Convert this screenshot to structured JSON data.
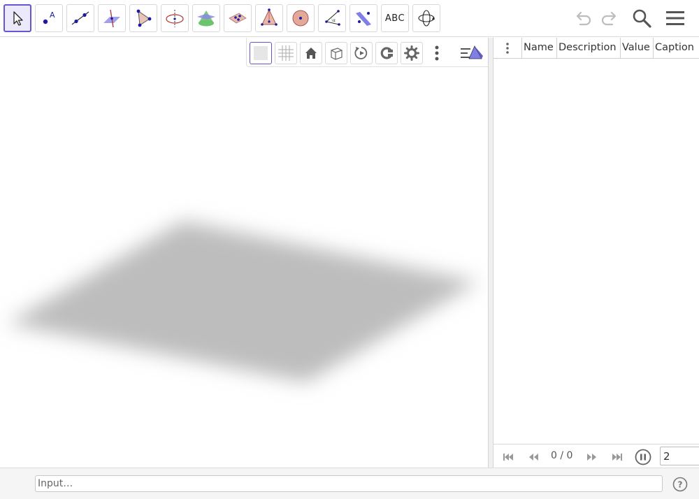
{
  "toolbar": {
    "tools": [
      {
        "name": "move-tool",
        "icon": "arrow-pointer-icon"
      },
      {
        "name": "point-tool",
        "icon": "point-icon"
      },
      {
        "name": "line-tool",
        "icon": "line-through-two-points-icon"
      },
      {
        "name": "perpendicular-line-tool",
        "icon": "perpendicular-line-icon"
      },
      {
        "name": "polygon-tool",
        "icon": "polygon-icon"
      },
      {
        "name": "circle-axis-tool",
        "icon": "circle-axis-icon"
      },
      {
        "name": "intersect-surfaces-tool",
        "icon": "intersect-surfaces-icon"
      },
      {
        "name": "plane-three-points-tool",
        "icon": "plane-icon"
      },
      {
        "name": "pyramid-tool",
        "icon": "pyramid-icon"
      },
      {
        "name": "sphere-tool",
        "icon": "sphere-icon"
      },
      {
        "name": "angle-tool",
        "icon": "angle-icon"
      },
      {
        "name": "reflect-tool",
        "icon": "reflect-about-plane-icon"
      },
      {
        "name": "text-tool",
        "label": "ABC"
      },
      {
        "name": "rotate-view-tool",
        "icon": "rotate-view-icon"
      }
    ],
    "undo_icon": "undo-icon",
    "redo_icon": "redo-icon",
    "search_icon": "search-icon",
    "menu_icon": "hamburger-menu-icon",
    "accent_color": "#6557d2"
  },
  "graphics": {
    "stylebar": {
      "buttons": [
        "axes-toggle-icon",
        "grid-icon",
        "home-icon",
        "view-cube-icon",
        "rotate-view-icon",
        "projection-icon",
        "settings-gear-icon",
        "more-vertical-icon",
        "toggle-stylebar-icon"
      ]
    },
    "plane_color": "#bdbdbd"
  },
  "table": {
    "columns": [
      "Name",
      "Description",
      "Value",
      "Caption"
    ],
    "rows": [],
    "navigation": {
      "counter": "0 / 0",
      "speed_value": "2"
    }
  },
  "input_bar": {
    "placeholder": "Input…",
    "help_icon": "help-question-icon"
  }
}
